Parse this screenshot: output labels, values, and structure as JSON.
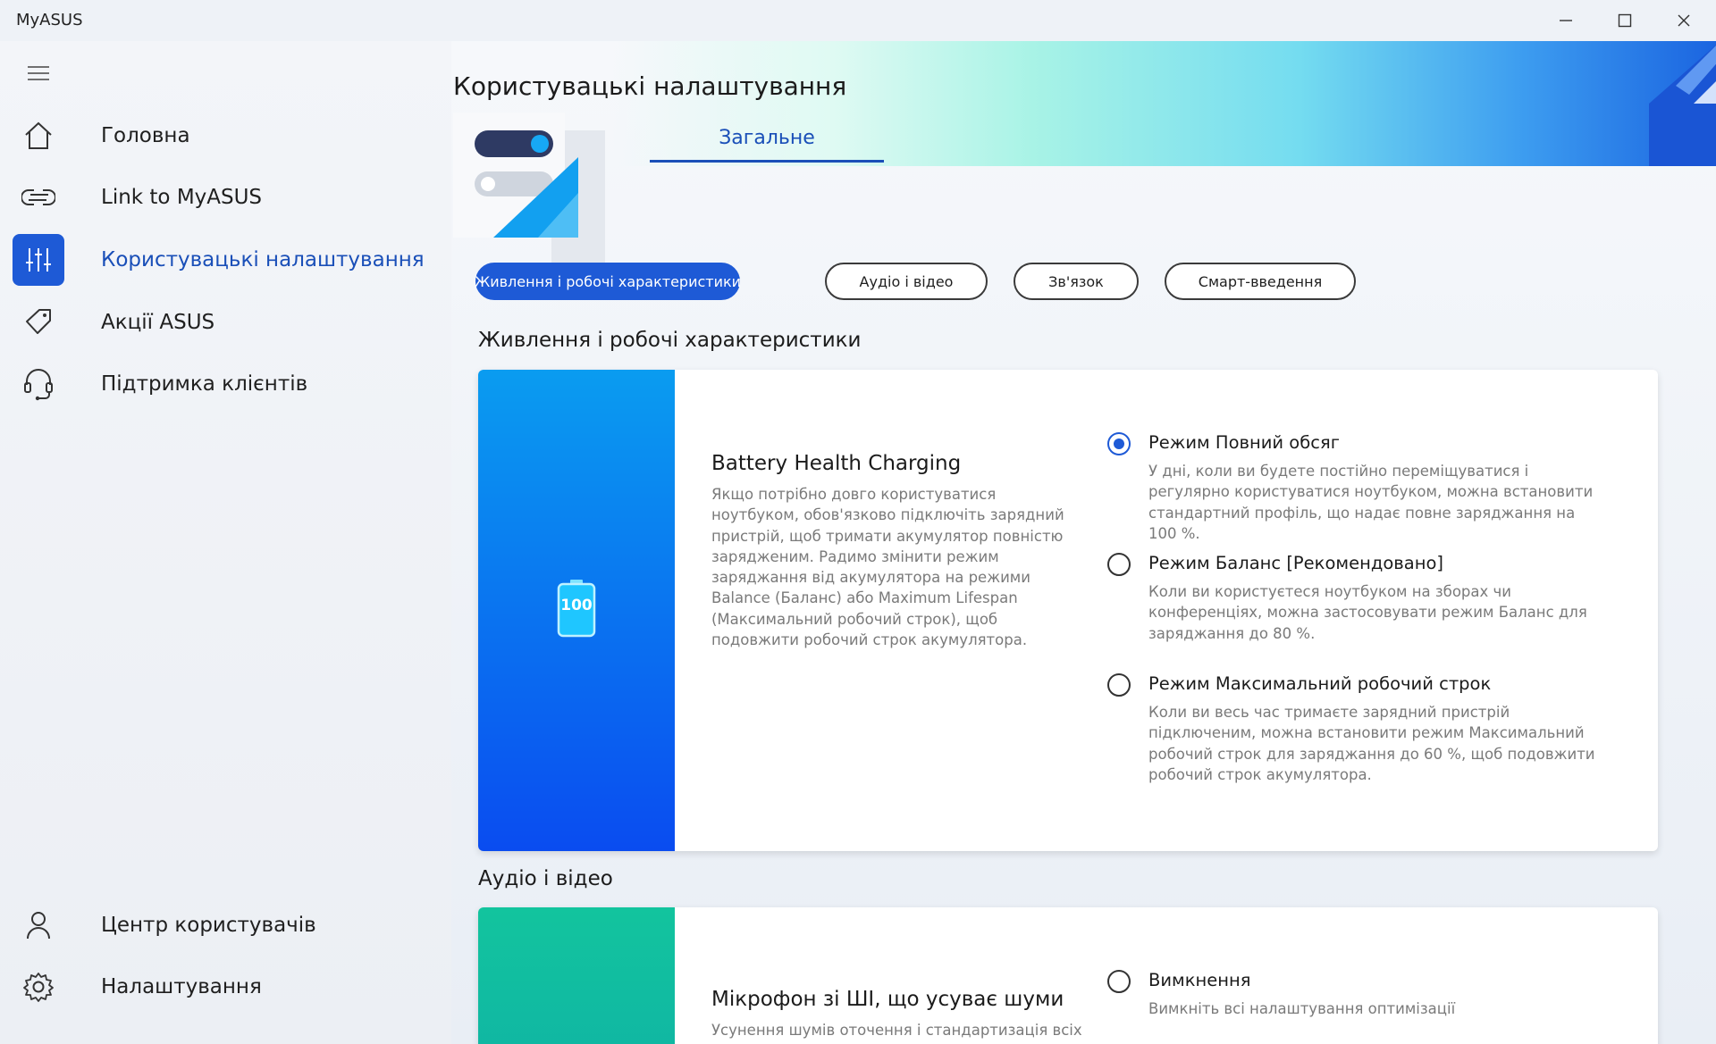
{
  "window": {
    "title": "MyASUS"
  },
  "sidebar": {
    "items": [
      {
        "label": "Головна",
        "icon": "home-icon"
      },
      {
        "label": "Link to MyASUS",
        "icon": "link-icon"
      },
      {
        "label": "Користувацькі налаштування",
        "icon": "sliders-icon",
        "active": true
      },
      {
        "label": "Акції ASUS",
        "icon": "tag-icon"
      },
      {
        "label": "Підтримка клієнтів",
        "icon": "headset-icon"
      }
    ],
    "bottom_items": [
      {
        "label": "Центр користувачів",
        "icon": "user-icon"
      },
      {
        "label": "Налаштування",
        "icon": "gear-icon"
      }
    ]
  },
  "main": {
    "page_title": "Користувацькі налаштування",
    "tabs": [
      {
        "label": "Загальне",
        "active": true
      }
    ],
    "chips": [
      {
        "label": "Живлення і робочі характеристики",
        "active": true
      },
      {
        "label": "Аудіо і відео"
      },
      {
        "label": "Зв'язок"
      },
      {
        "label": "Смарт-введення"
      }
    ],
    "sections": [
      {
        "heading": "Живлення і робочі характеристики",
        "feature": {
          "title": "Battery Health Charging",
          "description": "Якщо потрібно довго користуватися ноутбуком, обов'язково підключіть зарядний пристрій, щоб тримати акумулятор повністю зарядженим. Радимо змінити режим заряджання від акумулятора на режими Balance (Баланс) або Maximum Lifespan (Максимальний робочий строк), щоб подовжити робочий строк акумулятора.",
          "battery_label": "100",
          "options": [
            {
              "title": "Режим Повний обсяг",
              "description": "У дні, коли ви будете постійно переміщуватися і регулярно користуватися ноутбуком, можна встановити стандартний профіль, що надає повне заряджання на 100 %.",
              "selected": true
            },
            {
              "title": "Режим Баланс [Рекомендовано]",
              "description": "Коли ви користуєтеся ноутбуком на зборах чи конференціях, можна застосовувати режим Баланс для заряджання до 80 %.",
              "selected": false
            },
            {
              "title": "Режим Максимальний робочий строк",
              "description": "Коли ви весь час тримаєте зарядний пристрій підключеним, можна встановити режим Максимальний робочий строк для заряджання до 60 %, щоб подовжити робочий строк акумулятора.",
              "selected": false
            }
          ]
        }
      },
      {
        "heading": "Аудіо і відео",
        "feature": {
          "title": "Мікрофон зі ШІ, що усуває шуми",
          "description": "Усунення шумів оточення і стандартизація всіх",
          "options": [
            {
              "title": "Вимкнення",
              "description": "Вимкніть всі налаштування оптимізації",
              "selected": false
            }
          ]
        }
      }
    ]
  },
  "colors": {
    "accent": "#1e5ad6",
    "battery_gradient_top": "#0a9cf0",
    "battery_gradient_bottom": "#0a4cf0",
    "audio_gradient": "#12c49e"
  }
}
